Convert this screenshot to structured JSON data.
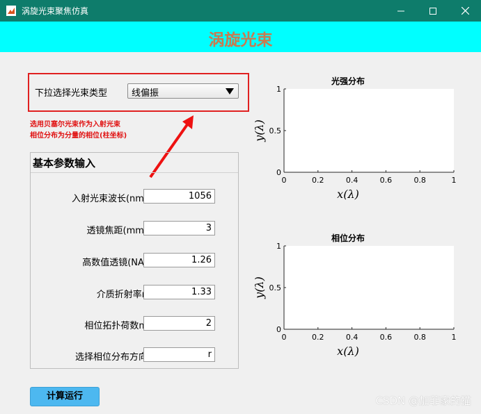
{
  "window": {
    "title": "涡旋光束聚焦仿真",
    "controls": [
      "minimize",
      "maximize",
      "close"
    ]
  },
  "banner": {
    "title": "涡旋光束"
  },
  "beam_select": {
    "label": "下拉选择光束类型",
    "selected": "线偏振"
  },
  "notes": [
    "选用贝塞尔光束作为入射光束",
    "相位分布为分量的相位(柱坐标)"
  ],
  "params": {
    "title": "基本参数输入",
    "rows": [
      {
        "label": "入射光束波长(nm)",
        "value": "1056"
      },
      {
        "label": "透镜焦距(mm)",
        "value": "3"
      },
      {
        "label": "高数值透镜(NA)",
        "value": "1.26"
      },
      {
        "label": "介质折射率n",
        "value": "1.33"
      },
      {
        "label": "相位拓扑荷数m",
        "value": "2"
      },
      {
        "label": "选择相位分布方向",
        "value": "r"
      }
    ]
  },
  "run_button": {
    "label": "计算运行"
  },
  "chart_data": [
    {
      "type": "scatter",
      "title": "光强分布",
      "xlabel": "x(λ)",
      "ylabel": "y(λ)",
      "xlim": [
        0,
        1
      ],
      "ylim": [
        0,
        1
      ],
      "xticks": [
        "0",
        "0.2",
        "0.4",
        "0.6",
        "0.8",
        "1"
      ],
      "yticks": [
        "0",
        "0.5",
        "1"
      ],
      "series": []
    },
    {
      "type": "scatter",
      "title": "相位分布",
      "xlabel": "x(λ)",
      "ylabel": "y(λ)",
      "xlim": [
        0,
        1
      ],
      "ylim": [
        0,
        1
      ],
      "xticks": [
        "0",
        "0.2",
        "0.4",
        "0.6",
        "0.8",
        "1"
      ],
      "yticks": [
        "0",
        "0.5",
        "1"
      ],
      "series": []
    }
  ],
  "watermark": "CSDN @加菲家的猫",
  "colors": {
    "titlebar": "#0e7c6b",
    "banner": "#00ffff",
    "banner_text": "#c87a50",
    "highlight": "#e02020",
    "run_button": "#4db8f0"
  }
}
